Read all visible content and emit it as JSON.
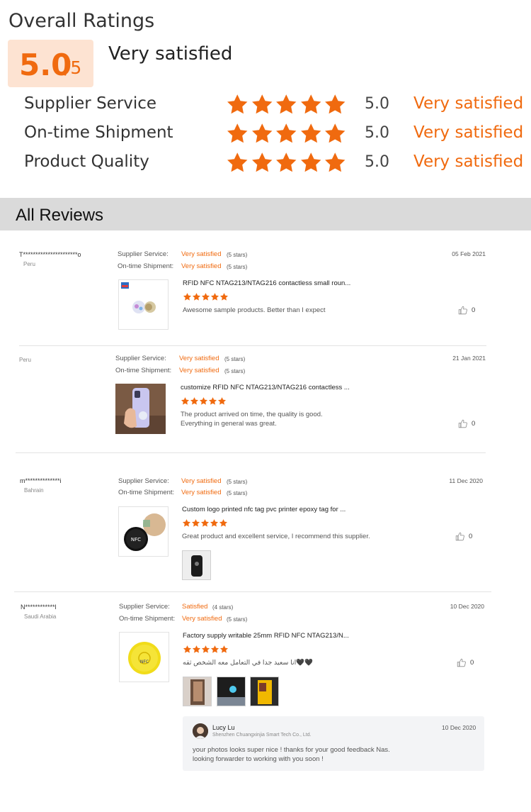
{
  "overall": {
    "title": "Overall Ratings",
    "score": "5.0",
    "score_max": "/5",
    "label": "Very satisfied",
    "metrics": [
      {
        "name": "Supplier Service",
        "value": "5.0",
        "label": "Very satisfied",
        "stars": 5
      },
      {
        "name": "On-time Shipment",
        "value": "5.0",
        "label": "Very satisfied",
        "stars": 5
      },
      {
        "name": "Product Quality",
        "value": "5.0",
        "label": "Very satisfied",
        "stars": 5
      }
    ]
  },
  "colors": {
    "accent": "#f06a0f",
    "score_bg": "#fde3d2",
    "header_bg": "#dadada"
  },
  "reviews": {
    "title": "All Reviews",
    "labels": {
      "supplier_service": "Supplier Service:",
      "on_time_shipment": "On-time Shipment:"
    },
    "items": [
      {
        "reviewer": "T**********************o",
        "country": "Peru",
        "date": "05 Feb 2021",
        "supplier_service": "Very satisfied",
        "supplier_service_count": "(5 stars)",
        "on_time_shipment": "Very satisfied",
        "on_time_shipment_count": "(5 stars)",
        "product_title": "RFID NFC NTAG213/NTAG216 contactless small roun...",
        "stars": 5,
        "text": [
          "Awesome sample products. Better than I expect"
        ],
        "likes": "0"
      },
      {
        "reviewer": "",
        "country": "Peru",
        "date": "21 Jan 2021",
        "supplier_service": "Very satisfied",
        "supplier_service_count": "(5 stars)",
        "on_time_shipment": "Very satisfied",
        "on_time_shipment_count": "(5 stars)",
        "product_title": "customize RFID NFC NTAG213/NTAG216 contactless ...",
        "stars": 5,
        "text": [
          "The product arrived on time, the quality is good.",
          "Everything in general was great."
        ],
        "likes": "0"
      },
      {
        "reviewer": "m**************i",
        "country": "Bahrain",
        "date": "11 Dec 2020",
        "supplier_service": "Very satisfied",
        "supplier_service_count": "(5 stars)",
        "on_time_shipment": "Very satisfied",
        "on_time_shipment_count": "(5 stars)",
        "product_title": "Custom logo printed nfc tag pvc printer epoxy tag for ...",
        "stars": 5,
        "text": [
          "Great product and excellent service, I recommend this supplier."
        ],
        "likes": "0"
      },
      {
        "reviewer": "N************l",
        "country": "Saudi Arabia",
        "date": "10 Dec 2020",
        "supplier_service": "Satisfied",
        "supplier_service_count": "(4 stars)",
        "on_time_shipment": "Very satisfied",
        "on_time_shipment_count": "(5 stars)",
        "product_title": "Factory supply writable 25mm RFID NFC NTAG213/N...",
        "stars": 5,
        "text": [
          "انا سعيد جدا في التعامل معه الشخص ثقه🖤🖤"
        ],
        "likes": "0",
        "reply": {
          "name": "Lucy Lu",
          "company": "Shenzhen Chuangxinjia Smart Tech Co., Ltd.",
          "date": "10 Dec 2020",
          "text": [
            "your photos looks super nice ! thanks for your good feedback Nas.",
            "looking forwarder to working with you soon !"
          ]
        }
      }
    ]
  },
  "thumbnail_badge": "NFC"
}
